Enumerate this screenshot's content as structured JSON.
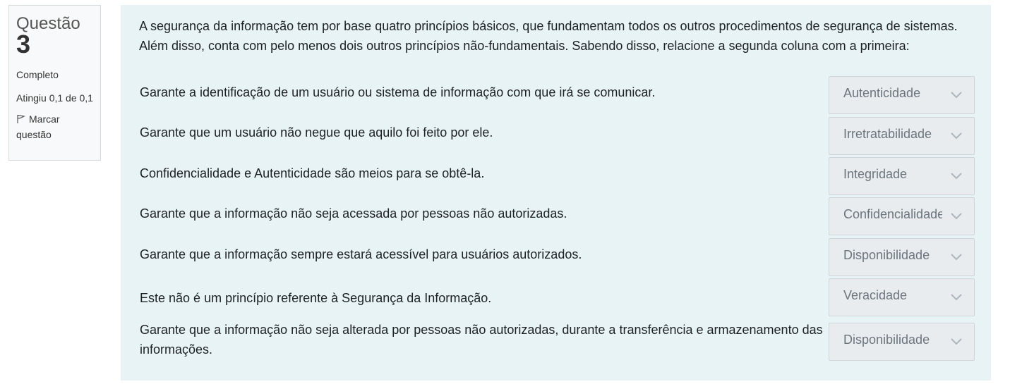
{
  "question_info": {
    "label": "Questão",
    "number": "3",
    "state": "Completo",
    "grade": "Atingiu 0,1 de 0,1",
    "flag_label": "Marcar questão"
  },
  "question": {
    "text_line1": "A segurança da informação tem por base quatro princípios básicos, que fundamentam todos os outros procedimentos de segurança de sistemas.",
    "text_line2": "Além disso, conta com pelo menos dois outros princípios não-fundamentais. Sabendo disso, relacione a segunda coluna com a primeira:",
    "rows": [
      {
        "text": "Garante a identificação de um usuário ou sistema de informação com que irá se comunicar.",
        "selected": "Autenticidade"
      },
      {
        "text": "Garante que um usuário não negue que aquilo foi feito por ele.",
        "selected": "Irretratabilidade"
      },
      {
        "text": "Confidencialidade e Autenticidade são meios para se obtê-la.",
        "selected": "Integridade"
      },
      {
        "text": "Garante que a informação não seja acessada por pessoas não autorizadas.",
        "selected": "Confidencialidade"
      },
      {
        "text": "Garante que a informação sempre estará acessível para usuários autorizados.",
        "selected": "Disponibilidade"
      },
      {
        "text": "Este não é um princípio referente à Segurança da Informação.",
        "selected": "Veracidade"
      },
      {
        "text": "Garante que a informação não seja alterada por pessoas não autorizadas, durante a transferência e armazenamento das informações.",
        "selected": "Disponibilidade"
      }
    ]
  }
}
